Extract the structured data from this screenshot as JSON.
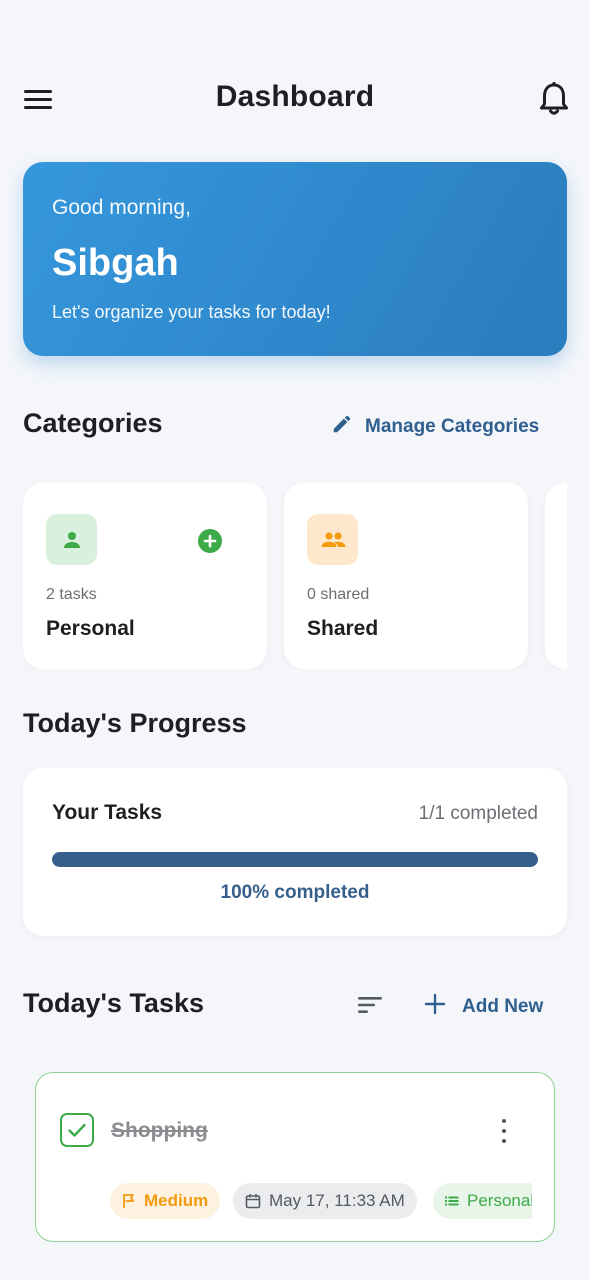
{
  "header": {
    "title": "Dashboard",
    "menu_icon": "menu-icon",
    "bell_icon": "bell-icon"
  },
  "greeting": {
    "salutation": "Good morning,",
    "name": "Sibgah",
    "subtitle": "Let's organize your tasks for today!"
  },
  "categories": {
    "heading": "Categories",
    "manage_label": "Manage Categories",
    "items": [
      {
        "count": "2 tasks",
        "name": "Personal",
        "icon": "person-icon",
        "icon_bg": "#d9f0dc",
        "icon_color": "#3cab48"
      },
      {
        "count": "0 shared",
        "name": "Shared",
        "icon": "group-icon",
        "icon_bg": "#fde8cc",
        "icon_color": "#f39b0f"
      }
    ]
  },
  "progress": {
    "heading": "Today's Progress",
    "label": "Your Tasks",
    "count": "1/1 completed",
    "fraction": 1.0,
    "percent_label": "100% completed"
  },
  "tasks": {
    "heading": "Today's Tasks",
    "add_label": "Add New",
    "items": [
      {
        "title": "Shopping",
        "completed": true,
        "priority": "Medium",
        "date": "May 17, 11:33 AM",
        "category": "Personal"
      }
    ]
  },
  "colors": {
    "accent": "#2f5f8f",
    "greeting_bg": "#3697dc",
    "success": "#3cab48",
    "warning": "#f39b0f"
  }
}
